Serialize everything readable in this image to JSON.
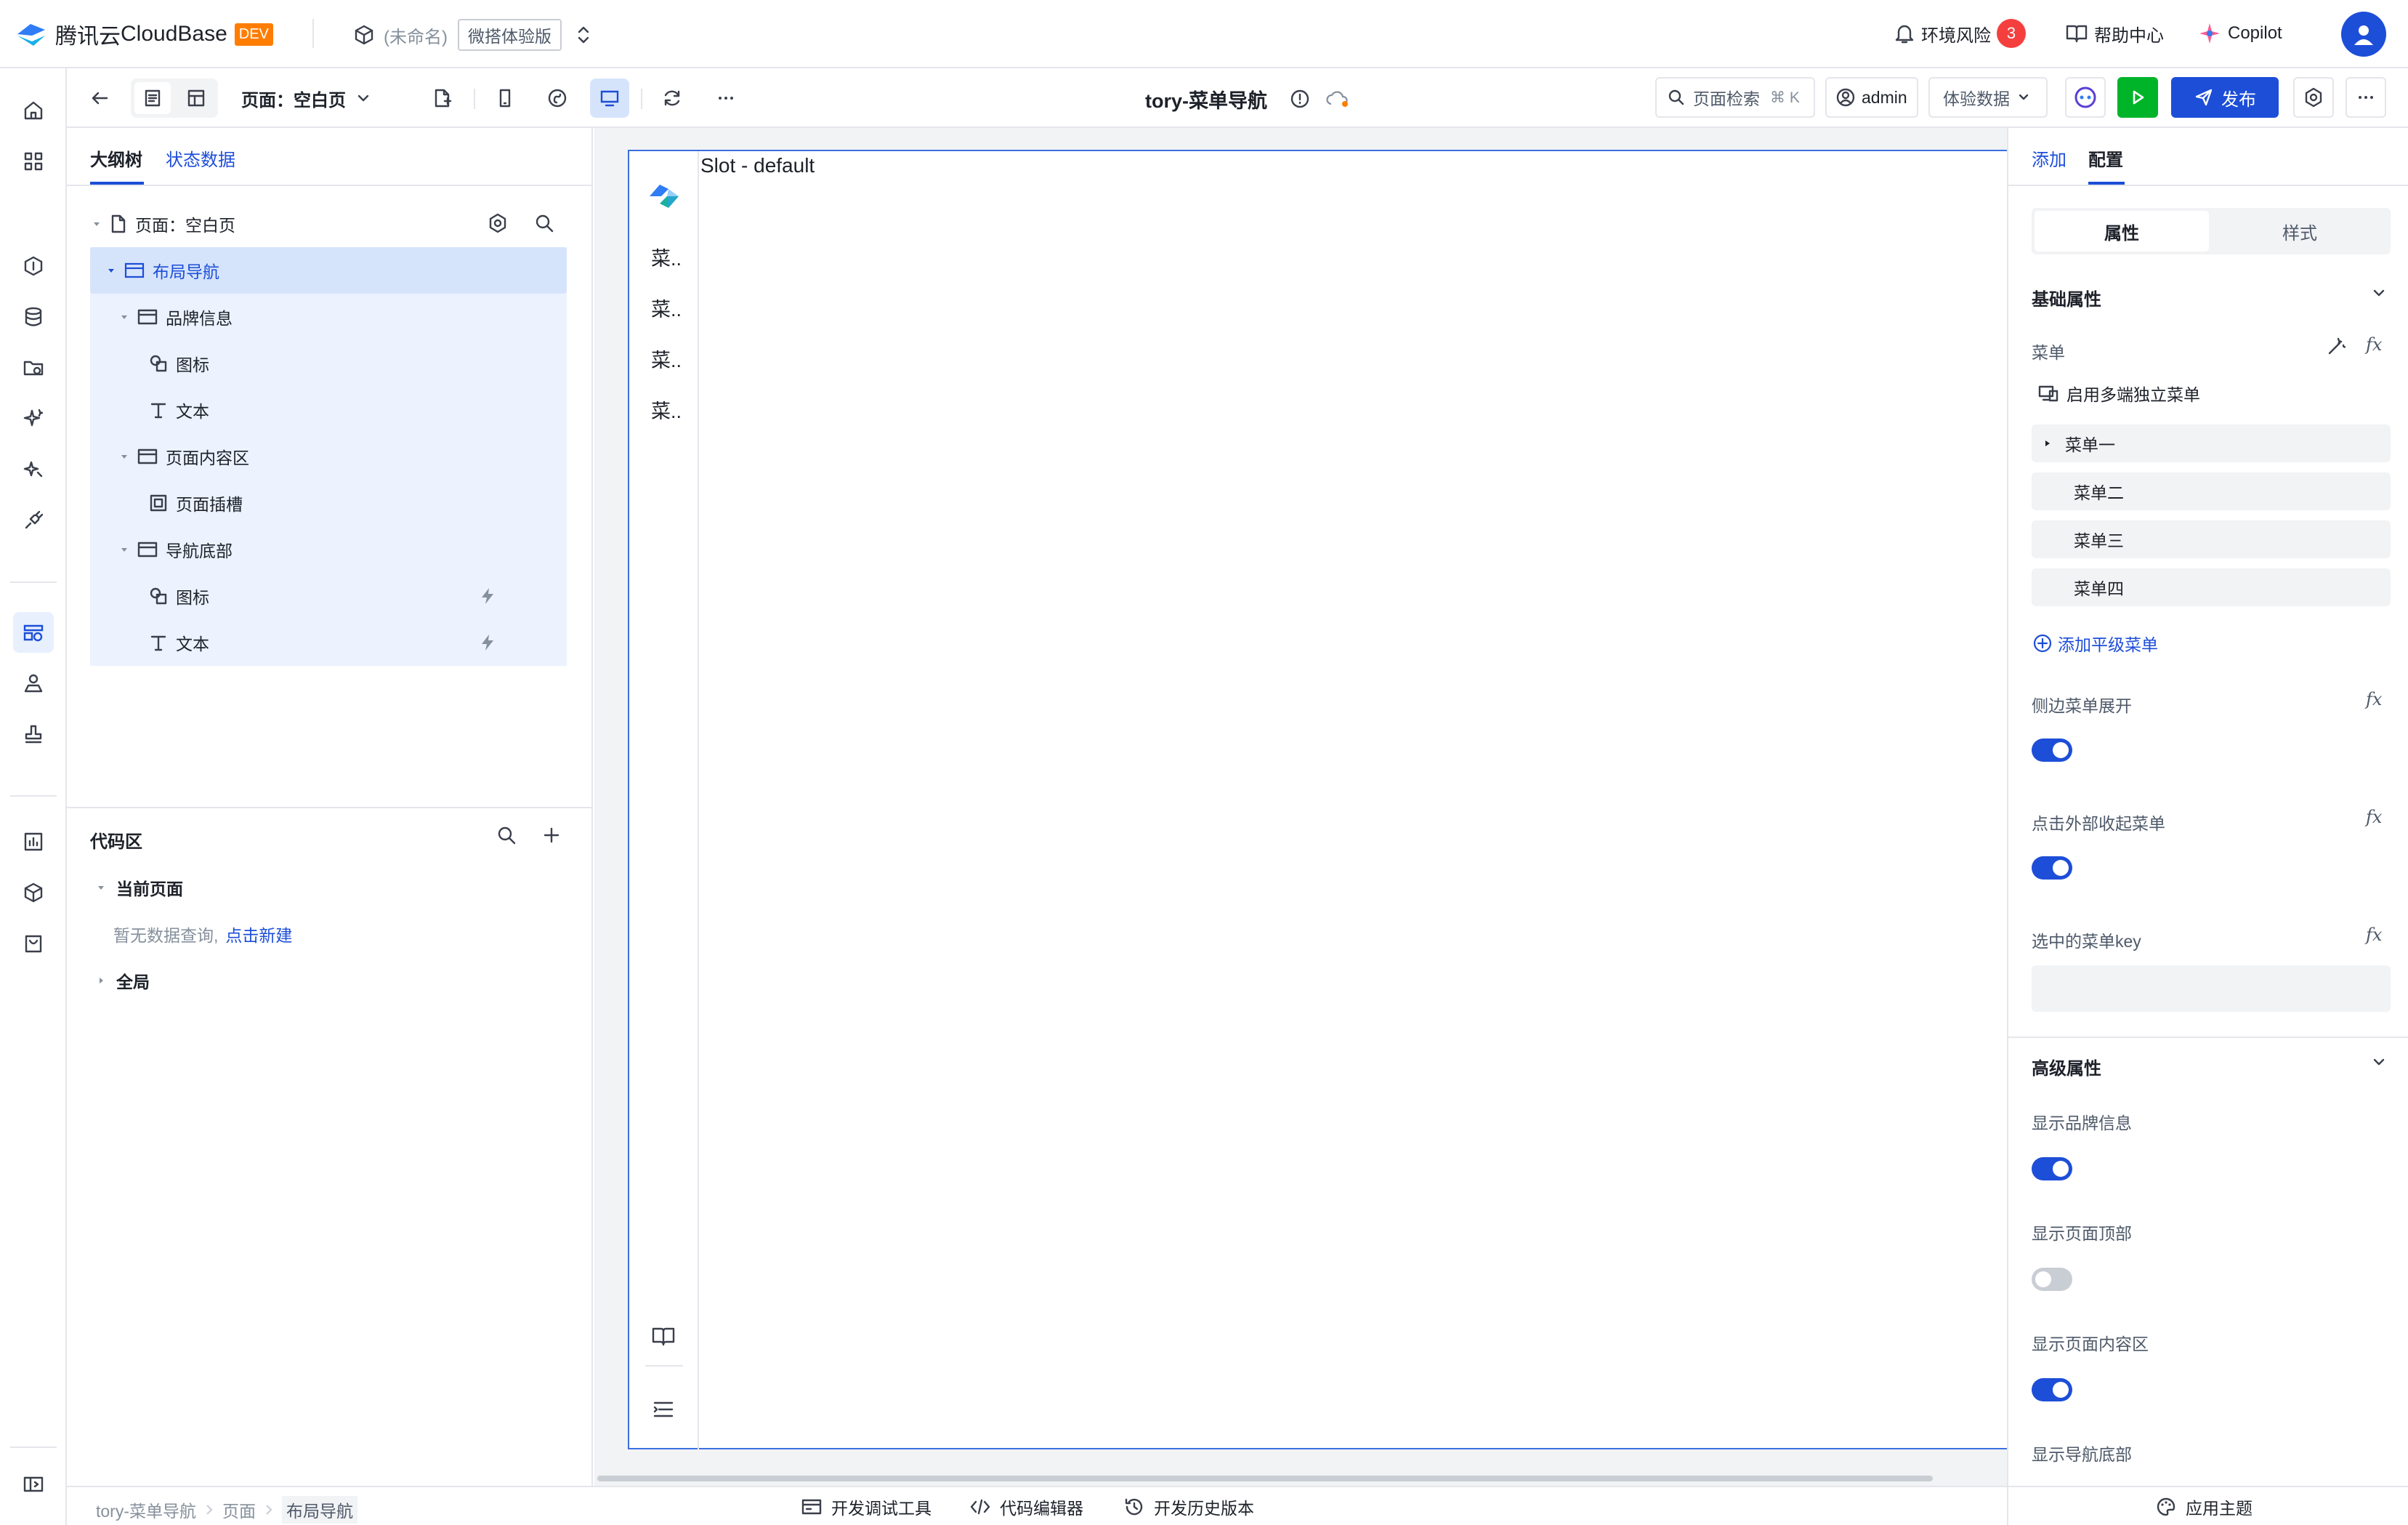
{
  "header": {
    "brand": "腾讯云",
    "product": "CloudBase",
    "env_badge": "DEV",
    "app_name": "(未命名)",
    "edition": "微搭体验版",
    "env_risk_label": "环境风险",
    "env_risk_count": "3",
    "help_label": "帮助中心",
    "copilot_label": "Copilot"
  },
  "toolbar": {
    "page_selector": "页面：空白页",
    "page_title": "tory-菜单导航",
    "search_label": "页面检索",
    "search_shortcut": "⌘ K",
    "user_label": "admin",
    "data_mode": "体验数据",
    "publish_label": "发布"
  },
  "left_panel": {
    "tabs": [
      "大纲树",
      "状态数据"
    ],
    "tree": {
      "page_label": "页面：空白页",
      "nodes": [
        {
          "label": "布局导航",
          "level": 1
        },
        {
          "label": "品牌信息",
          "level": 2
        },
        {
          "label": "图标",
          "level": 3
        },
        {
          "label": "文本",
          "level": 3
        },
        {
          "label": "页面内容区",
          "level": 2
        },
        {
          "label": "页面插槽",
          "level": 3
        },
        {
          "label": "导航底部",
          "level": 2
        },
        {
          "label": "图标",
          "level": 3
        },
        {
          "label": "文本",
          "level": 3
        }
      ]
    },
    "code": {
      "title": "代码区",
      "current_page": "当前页面",
      "empty_text": "暂无数据查询,",
      "create_link": "点击新建",
      "global": "全局"
    }
  },
  "canvas": {
    "slot_label": "Slot - default",
    "menu_items": [
      "菜..",
      "菜..",
      "菜..",
      "菜.."
    ]
  },
  "right_panel": {
    "tabs": [
      "添加",
      "配置"
    ],
    "segment": [
      "属性",
      "样式"
    ],
    "basic_title": "基础属性",
    "menu_label": "菜单",
    "multi_menu_label": "启用多端独立菜单",
    "menus": [
      "菜单一",
      "菜单二",
      "菜单三",
      "菜单四"
    ],
    "add_menu": "添加平级菜单",
    "side_expand_label": "侧边菜单展开",
    "click_collapse_label": "点击外部收起菜单",
    "selected_key_label": "选中的菜单key",
    "advanced_title": "高级属性",
    "show_brand_label": "显示品牌信息",
    "show_top_label": "显示页面顶部",
    "show_content_label": "显示页面内容区",
    "show_footer_label": "显示导航底部"
  },
  "status_bar": {
    "breadcrumb": [
      "tory-菜单导航",
      "页面",
      "布局导航"
    ],
    "debug_tool": "开发调试工具",
    "code_editor": "代码编辑器",
    "history": "开发历史版本",
    "theme": "应用主题"
  },
  "colors": {
    "accent": "#1d4ed8",
    "selected_bg": "#d6e4fb",
    "tree_bg": "#ecf2fe",
    "risk_badge": "#f53f3f",
    "run_button": "#00b42a",
    "dev_badge": "#ff7d00"
  }
}
